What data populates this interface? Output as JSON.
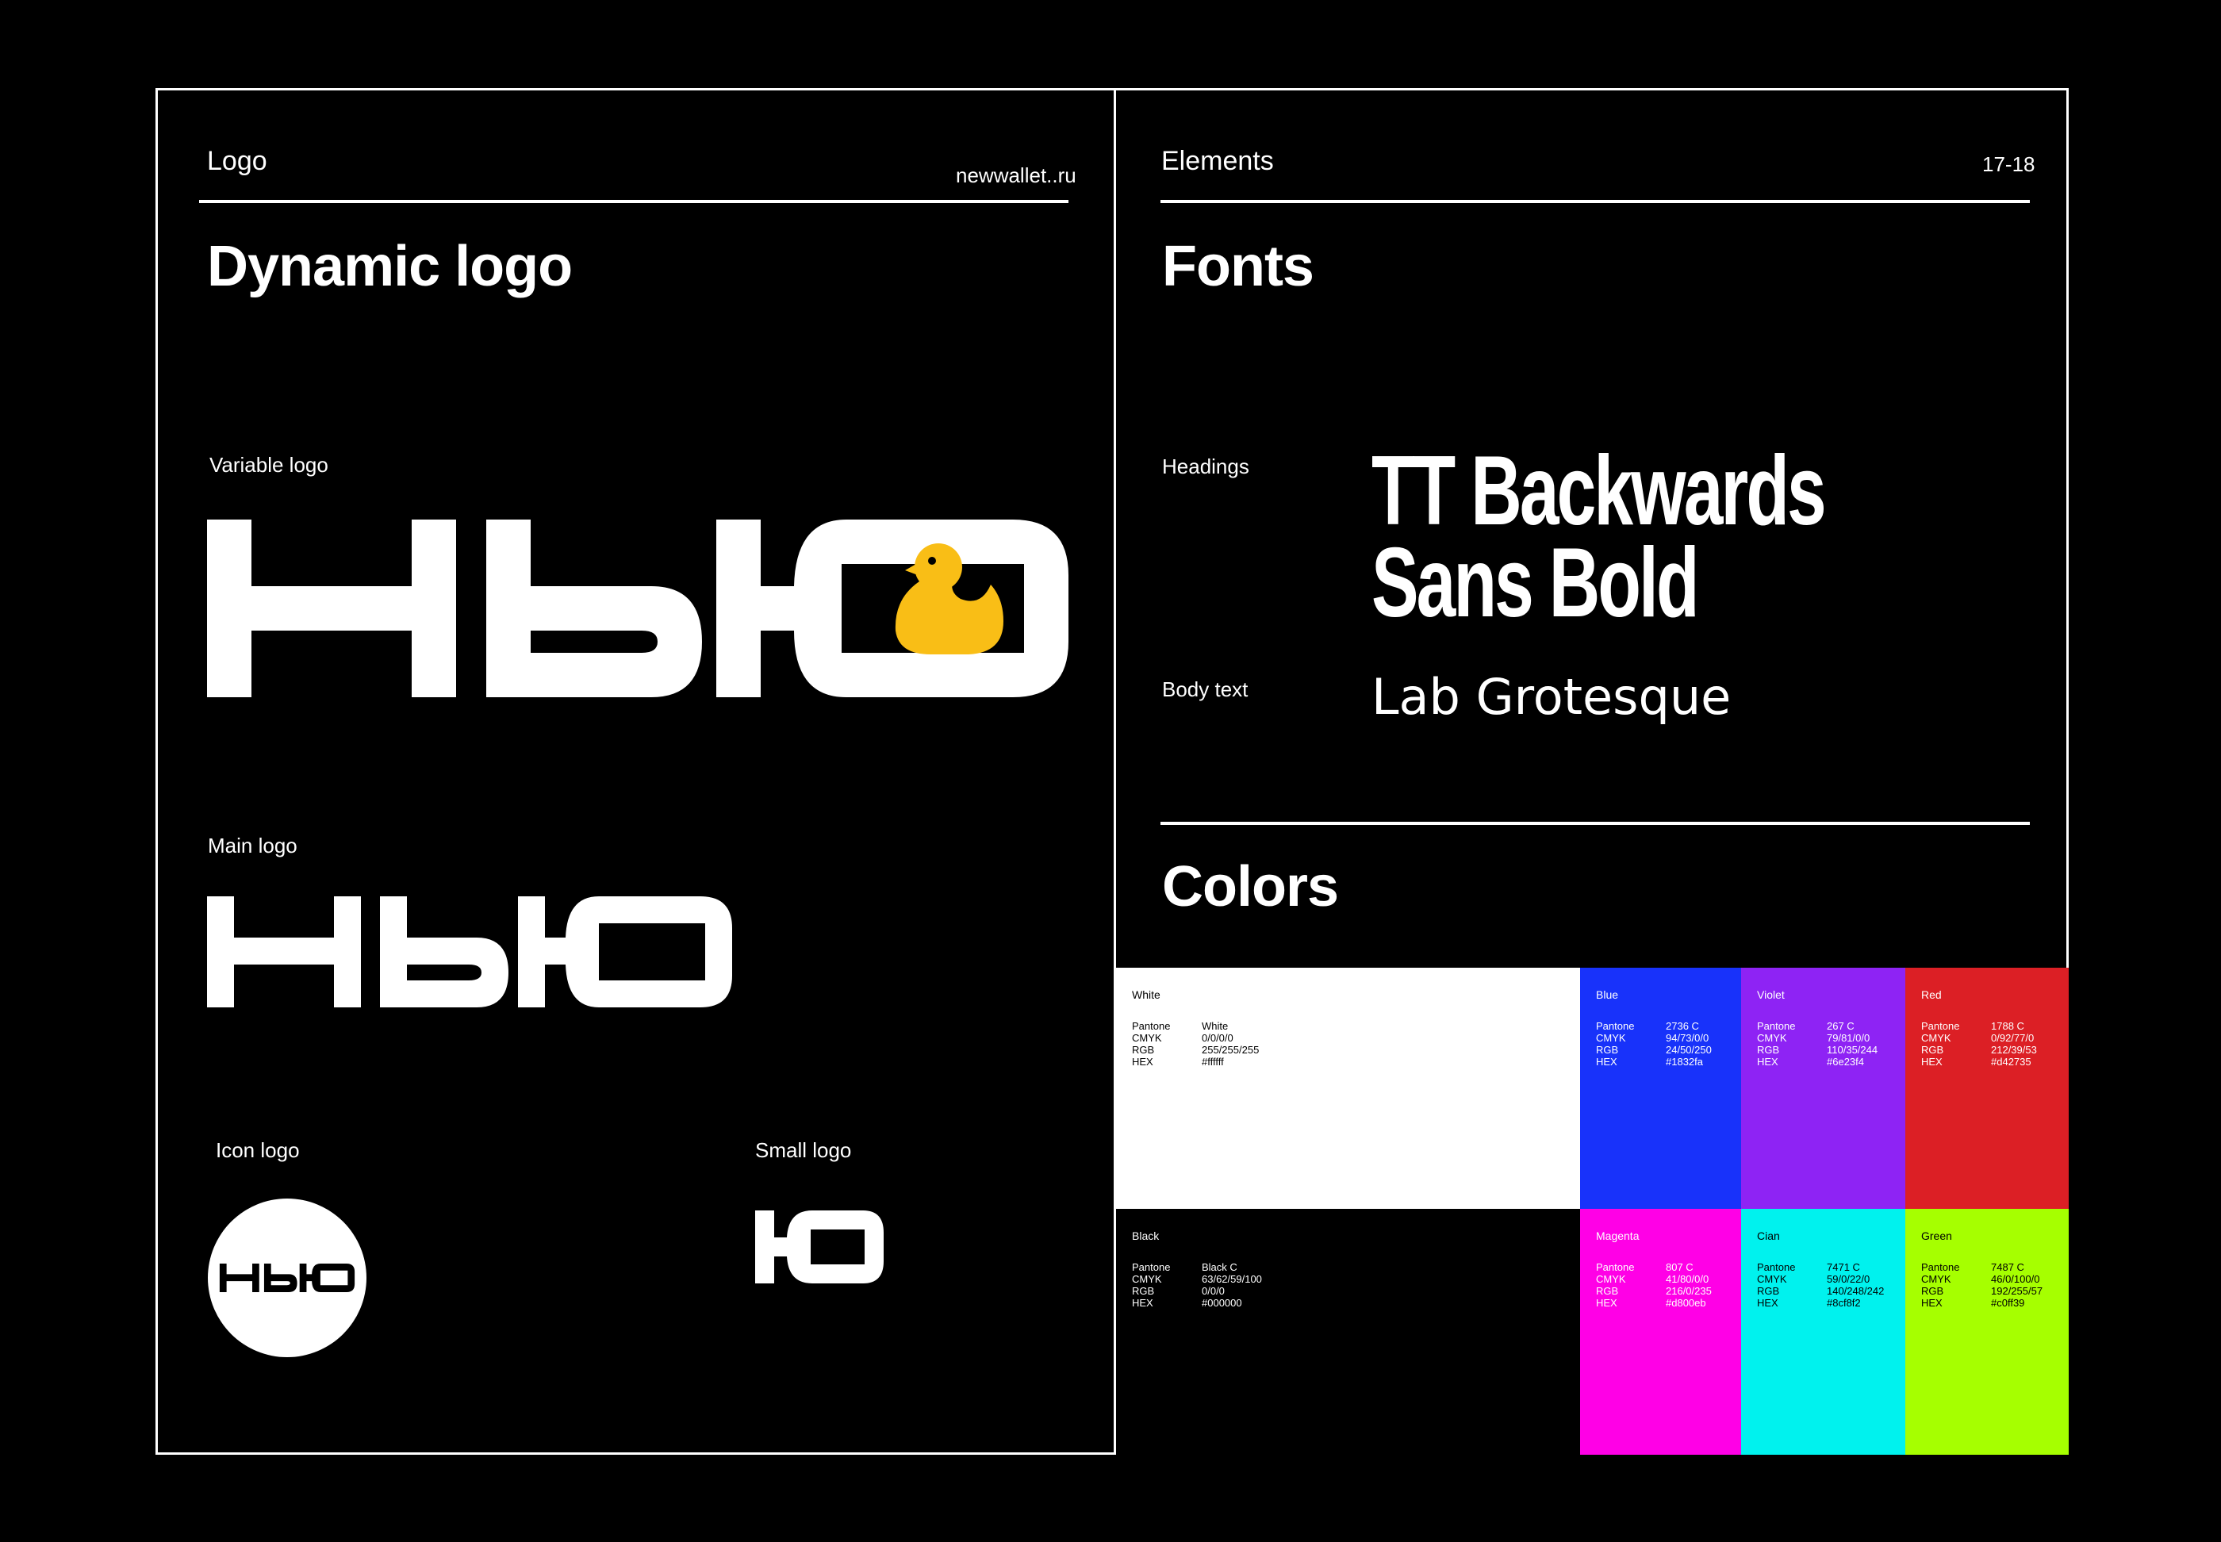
{
  "left_page": {
    "section": "Logo",
    "site": "newwallet..ru",
    "title": "Dynamic logo",
    "variable_label": "Variable logo",
    "main_label": "Main logo",
    "icon_label": "Icon logo",
    "small_label": "Small logo",
    "logo_word": "НЬЮ",
    "small_logo_glyph": "Ю"
  },
  "right_page": {
    "section": "Elements",
    "pages": "17-18",
    "fonts_title": "Fonts",
    "headings_label": "Headings",
    "headings_font_line1": "TT Backwards",
    "headings_font_line2": "Sans Bold",
    "body_label": "Body text",
    "body_font": "Lab Grotesque",
    "colors_title": "Colors"
  },
  "colors": {
    "keys": [
      "Pantone",
      "CMYK",
      "RGB",
      "HEX"
    ],
    "swatches": [
      {
        "name": "White",
        "bg": "#ffffff",
        "fg": "#000000",
        "values": [
          "White",
          "0/0/0/0",
          "255/255/255",
          "#ffffff"
        ]
      },
      {
        "name": "Blue",
        "bg": "#1832fa",
        "fg": "#ffffff",
        "values": [
          "2736 C",
          "94/73/0/0",
          "24/50/250",
          "#1832fa"
        ]
      },
      {
        "name": "Violet",
        "bg": "#8e23f4",
        "fg": "#ffffff",
        "values": [
          "267 C",
          "79/81/0/0",
          "110/35/244",
          "#6e23f4"
        ]
      },
      {
        "name": "Red",
        "bg": "#dc1f25",
        "fg": "#ffffff",
        "values": [
          "1788 C",
          "0/92/77/0",
          "212/39/53",
          "#d42735"
        ]
      },
      {
        "name": "Black",
        "bg": "#000000",
        "fg": "#ffffff",
        "values": [
          "Black C",
          "63/62/59/100",
          "0/0/0",
          "#000000"
        ]
      },
      {
        "name": "Magenta",
        "bg": "#ff00e6",
        "fg": "#ffffff",
        "values": [
          "807 C",
          "41/80/0/0",
          "216/0/235",
          "#d800eb"
        ]
      },
      {
        "name": "Cian",
        "bg": "#00f2ee",
        "fg": "#000000",
        "values": [
          "7471 C",
          "59/0/22/0",
          "140/248/242",
          "#8cf8f2"
        ]
      },
      {
        "name": "Green",
        "bg": "#a6ff00",
        "fg": "#000000",
        "values": [
          "7487 C",
          "46/0/100/0",
          "192/255/57",
          "#c0ff39"
        ]
      }
    ]
  },
  "accent": {
    "duck": "#f9be16"
  }
}
